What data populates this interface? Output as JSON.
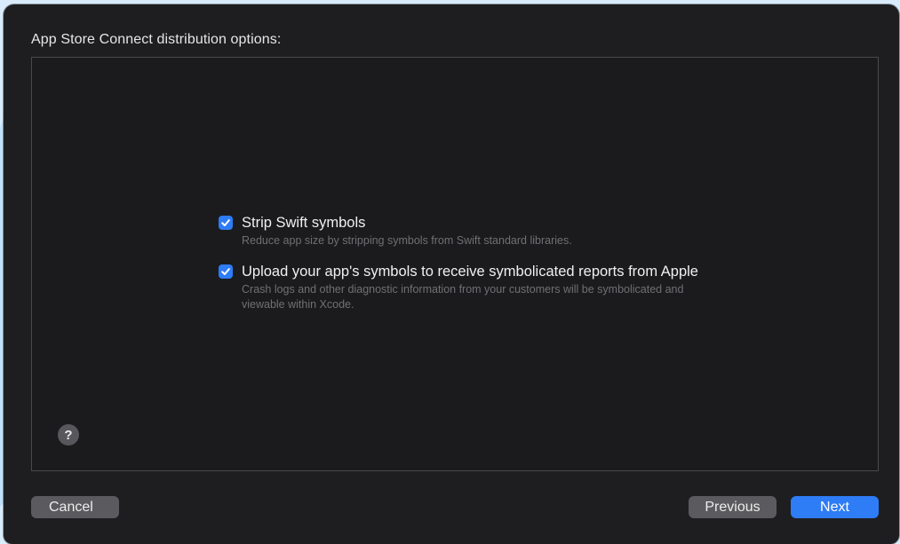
{
  "dialog": {
    "heading": "App Store Connect distribution options:"
  },
  "options": [
    {
      "checked": true,
      "title": "Strip Swift symbols",
      "description": "Reduce app size by stripping symbols from Swift standard libraries."
    },
    {
      "checked": true,
      "title": "Upload your app's symbols to receive symbolicated reports from Apple",
      "description": "Crash logs and other diagnostic information from your customers will be symbolicated and viewable within Xcode."
    }
  ],
  "help": {
    "label": "?"
  },
  "buttons": {
    "cancel": "Cancel",
    "previous": "Previous",
    "next": "Next"
  },
  "colors": {
    "accent": "#2e7cf6",
    "window_bg": "#1e1e20",
    "secondary_button": "#5b5b5f"
  }
}
